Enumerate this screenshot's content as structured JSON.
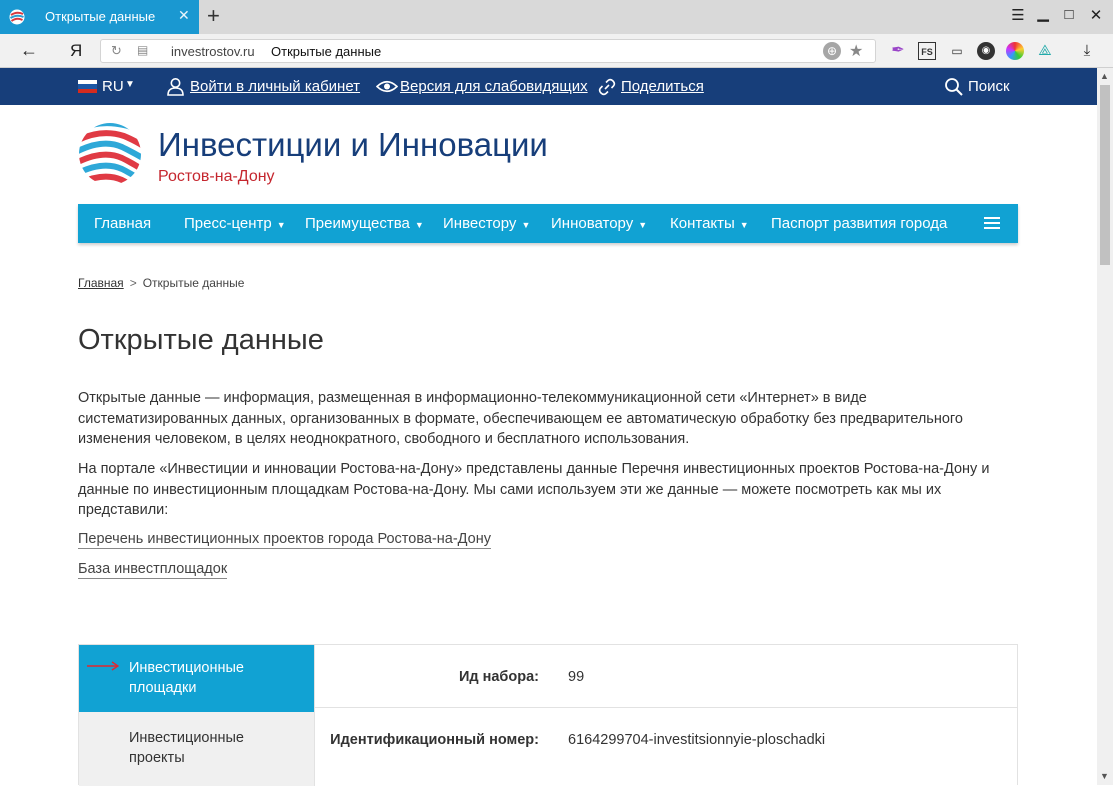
{
  "browser": {
    "tab_title": "Открытые данные",
    "url_domain": "investrostov.ru",
    "url_title": "Открытые данные",
    "search_engine_label": "Я"
  },
  "topbar": {
    "lang": "RU",
    "login": "Войти в личный кабинет",
    "accessibility": "Версия для слабовидящих",
    "share": "Поделиться",
    "search": "Поиск"
  },
  "header": {
    "title": "Инвестиции и Инновации",
    "subtitle": "Ростов-на-Дону"
  },
  "nav": {
    "items": [
      {
        "label": "Главная"
      },
      {
        "label": "Пресс-центр"
      },
      {
        "label": "Преимущества"
      },
      {
        "label": "Инвестору"
      },
      {
        "label": "Инноватору"
      },
      {
        "label": "Контакты"
      },
      {
        "label": "Паспорт развития города"
      }
    ]
  },
  "breadcrumbs": {
    "home": "Главная",
    "separator": ">",
    "current": "Открытые данные"
  },
  "page": {
    "title": "Открытые данные",
    "paragraph1": "Открытые данные — информация, размещенная в информационно-телекоммуникационной сети «Интернет» в виде систематизированных данных, организованных в формате, обеспечивающем ее автоматическую обработку без предварительного изменения человеком, в целях неоднократного, свободного и бесплатного использования.",
    "paragraph2": "На портале «Инвестиции и инновации Ростова-на-Дону» представлены данные Перечня инвестиционных проектов Ростова-на-Дону и данные по инвестиционным площадкам Ростова-на-Дону. Мы сами используем эти же данные — можете посмотреть как мы их представили:",
    "link1": "Перечень инвестиционных проектов города Ростова-на-Дону",
    "link2": "База инвестплощадок"
  },
  "dataset": {
    "sidebar": {
      "active": "Инвестиционные площадки",
      "inactive": "Инвестиционные проекты"
    },
    "fields": [
      {
        "label": "Ид набора:",
        "value": "99"
      },
      {
        "label": "Идентификационный номер:",
        "value": "6164299704-investitsionnyie-ploschadki"
      }
    ]
  },
  "colors": {
    "topbar": "#173e7a",
    "nav": "#11a2d3",
    "accent_red": "#c5262e",
    "tab": "#1a98d1"
  }
}
